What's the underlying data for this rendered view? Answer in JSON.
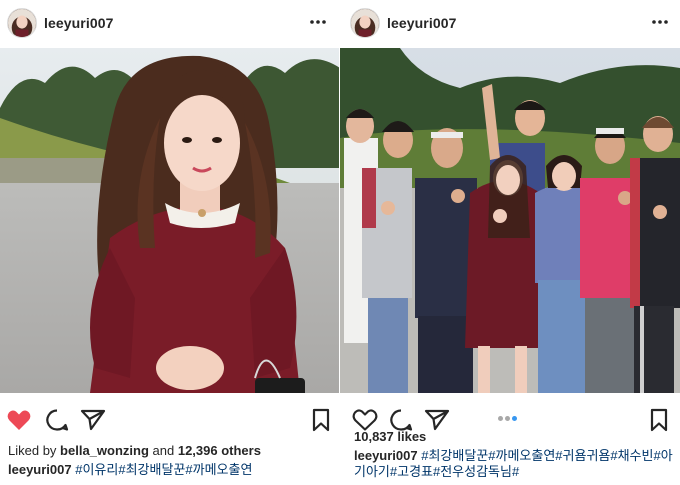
{
  "posts": [
    {
      "username": "leeyuri007",
      "liked": true,
      "likes_prefix": "Liked by",
      "liked_by": "bella_wonzing",
      "likes_and": "and",
      "likes_others": "12,396 others",
      "caption_user": "leeyuri007",
      "caption_tags": "#이유리#최강배달꾼#까메오출연"
    },
    {
      "username": "leeyuri007",
      "liked": false,
      "likes_count": "10,837 likes",
      "carousel": {
        "count": 3,
        "active_index": 2
      },
      "caption_user": "leeyuri007",
      "caption_tags": "#최강배달꾼#까메오출연#귀욤귀욤#채수빈#아기아기#고경표#전우성감독님#"
    }
  ],
  "icons": {
    "more": "more-dots-icon",
    "like": "heart-icon",
    "comment": "comment-icon",
    "share": "paper-plane-icon",
    "save": "bookmark-icon"
  },
  "colors": {
    "liked_heart": "#ed4956",
    "hashtag": "#003569",
    "text": "#262626",
    "carousel_active": "#3897f0",
    "carousel_inactive": "#a8a8a8"
  }
}
